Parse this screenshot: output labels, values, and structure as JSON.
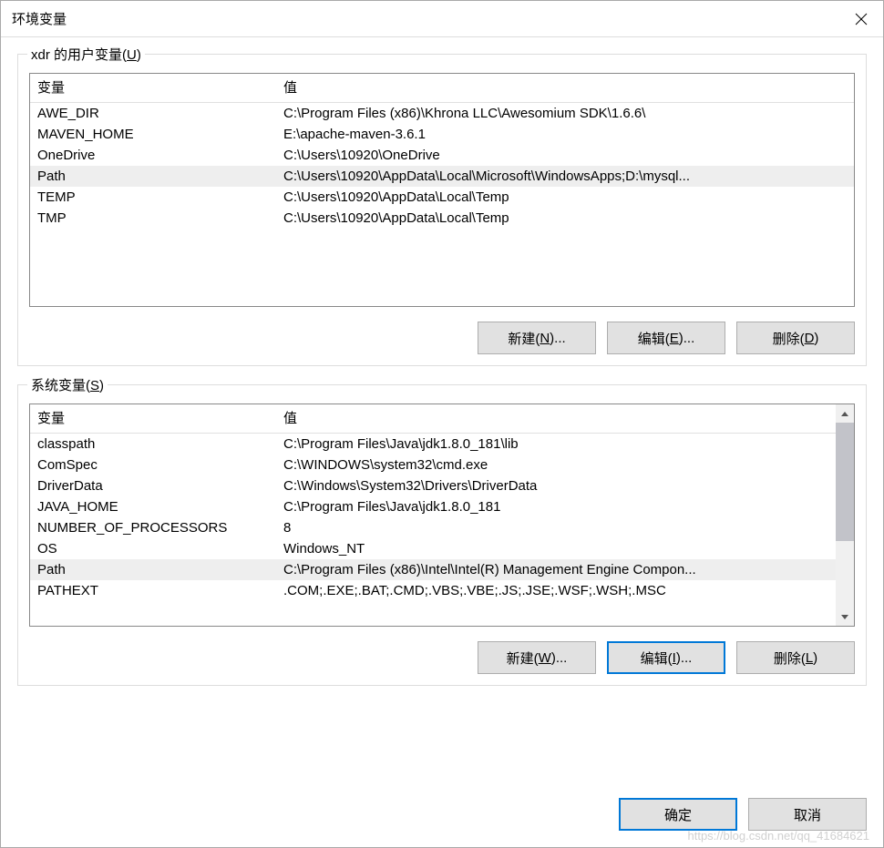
{
  "window": {
    "title": "环境变量"
  },
  "userVars": {
    "legend_prefix": "xdr 的用户变量(",
    "legend_key": "U",
    "legend_suffix": ")",
    "headers": {
      "name": "变量",
      "value": "值"
    },
    "rows": [
      {
        "name": "AWE_DIR",
        "value": "C:\\Program Files (x86)\\Khrona LLC\\Awesomium SDK\\1.6.6\\",
        "selected": false
      },
      {
        "name": "MAVEN_HOME",
        "value": "E:\\apache-maven-3.6.1",
        "selected": false
      },
      {
        "name": "OneDrive",
        "value": "C:\\Users\\10920\\OneDrive",
        "selected": false
      },
      {
        "name": "Path",
        "value": "C:\\Users\\10920\\AppData\\Local\\Microsoft\\WindowsApps;D:\\mysql...",
        "selected": true
      },
      {
        "name": "TEMP",
        "value": "C:\\Users\\10920\\AppData\\Local\\Temp",
        "selected": false
      },
      {
        "name": "TMP",
        "value": "C:\\Users\\10920\\AppData\\Local\\Temp",
        "selected": false
      }
    ],
    "buttons": {
      "new_prefix": "新建(",
      "new_key": "N",
      "new_suffix": ")...",
      "edit_prefix": "编辑(",
      "edit_key": "E",
      "edit_suffix": ")...",
      "delete_prefix": "删除(",
      "delete_key": "D",
      "delete_suffix": ")"
    }
  },
  "sysVars": {
    "legend_prefix": "系统变量(",
    "legend_key": "S",
    "legend_suffix": ")",
    "headers": {
      "name": "变量",
      "value": "值"
    },
    "rows": [
      {
        "name": "classpath",
        "value": "C:\\Program Files\\Java\\jdk1.8.0_181\\lib",
        "selected": false
      },
      {
        "name": "ComSpec",
        "value": "C:\\WINDOWS\\system32\\cmd.exe",
        "selected": false
      },
      {
        "name": "DriverData",
        "value": "C:\\Windows\\System32\\Drivers\\DriverData",
        "selected": false
      },
      {
        "name": "JAVA_HOME",
        "value": "C:\\Program Files\\Java\\jdk1.8.0_181",
        "selected": false
      },
      {
        "name": "NUMBER_OF_PROCESSORS",
        "value": "8",
        "selected": false
      },
      {
        "name": "OS",
        "value": "Windows_NT",
        "selected": false
      },
      {
        "name": "Path",
        "value": "C:\\Program Files (x86)\\Intel\\Intel(R) Management Engine Compon...",
        "selected": true
      },
      {
        "name": "PATHEXT",
        "value": ".COM;.EXE;.BAT;.CMD;.VBS;.VBE;.JS;.JSE;.WSF;.WSH;.MSC",
        "selected": false
      }
    ],
    "buttons": {
      "new_prefix": "新建(",
      "new_key": "W",
      "new_suffix": ")...",
      "edit_prefix": "编辑(",
      "edit_key": "I",
      "edit_suffix": ")...",
      "delete_prefix": "删除(",
      "delete_key": "L",
      "delete_suffix": ")"
    }
  },
  "bottom": {
    "ok": "确定",
    "cancel": "取消"
  },
  "watermark": "https://blog.csdn.net/qq_41684621"
}
